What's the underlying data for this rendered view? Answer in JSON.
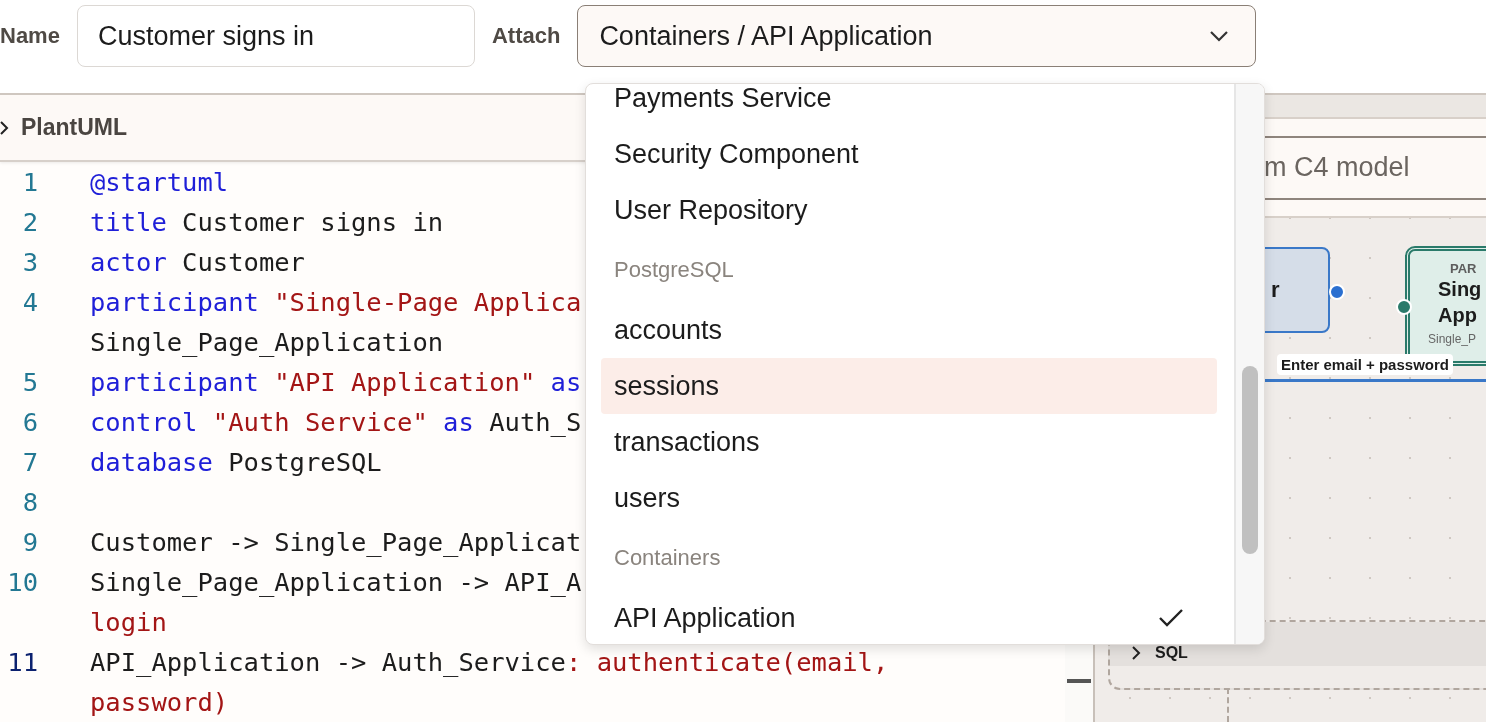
{
  "form": {
    "name_label": "Name",
    "name_value": "Customer signs in",
    "attach_label": "Attach",
    "attach_value": "Containers / API Application"
  },
  "editor": {
    "title": "PlantUML",
    "lines": [
      {
        "number": "1",
        "active": false,
        "rows": [
          [
            {
              "t": "@startuml",
              "kind": "keyword"
            }
          ]
        ]
      },
      {
        "number": "2",
        "active": false,
        "rows": [
          [
            {
              "t": "title",
              "kind": "keyword"
            },
            {
              "t": " Customer signs in",
              "kind": "plain"
            }
          ]
        ]
      },
      {
        "number": "3",
        "active": false,
        "rows": [
          [
            {
              "t": "actor",
              "kind": "keyword"
            },
            {
              "t": " Customer",
              "kind": "plain"
            }
          ]
        ]
      },
      {
        "number": "4",
        "active": false,
        "rows": [
          [
            {
              "t": "participant",
              "kind": "keyword"
            },
            {
              "t": " \"Single-Page Applica",
              "kind": "string"
            }
          ],
          [
            {
              "t": "Single_Page_Application",
              "kind": "plain"
            }
          ]
        ]
      },
      {
        "number": "5",
        "active": false,
        "rows": [
          [
            {
              "t": "participant",
              "kind": "keyword"
            },
            {
              "t": " \"API Application\"",
              "kind": "string"
            },
            {
              "t": " as",
              "kind": "keyword"
            }
          ]
        ]
      },
      {
        "number": "6",
        "active": false,
        "rows": [
          [
            {
              "t": "control",
              "kind": "keyword"
            },
            {
              "t": " \"Auth Service\"",
              "kind": "string"
            },
            {
              "t": " as",
              "kind": "keyword"
            },
            {
              "t": " Auth_S",
              "kind": "plain"
            }
          ]
        ]
      },
      {
        "number": "7",
        "active": false,
        "rows": [
          [
            {
              "t": "database",
              "kind": "keyword"
            },
            {
              "t": " PostgreSQL",
              "kind": "plain"
            }
          ]
        ]
      },
      {
        "number": "8",
        "active": false,
        "rows": [
          []
        ]
      },
      {
        "number": "9",
        "active": false,
        "rows": [
          [
            {
              "t": "Customer -> Single_Page_Applicat",
              "kind": "plain"
            }
          ]
        ]
      },
      {
        "number": "10",
        "active": false,
        "rows": [
          [
            {
              "t": "Single_Page_Application -> API_A",
              "kind": "plain"
            }
          ],
          [
            {
              "t": "login",
              "kind": "string"
            }
          ]
        ]
      },
      {
        "number": "11",
        "active": true,
        "rows": [
          [
            {
              "t": "API_Application -> Auth_Service",
              "kind": "plain"
            },
            {
              "t": ": authenticate(email,",
              "kind": "string"
            }
          ],
          [
            {
              "t": "password)",
              "kind": "string"
            }
          ]
        ]
      }
    ]
  },
  "preview": {
    "search_value": "m C4 model",
    "person_node": {
      "name": "r"
    },
    "container_node": {
      "tag": "PAR",
      "title_lines": [
        "Sing",
        "App"
      ],
      "subtitle": "Single_P"
    },
    "edge_label": "Enter email + password",
    "group_label": "SQL"
  },
  "dropdown": {
    "items": [
      {
        "kind": "option",
        "label": "Payments Service",
        "selected": false,
        "highlighted": false
      },
      {
        "kind": "option",
        "label": "Security Component",
        "selected": false,
        "highlighted": false
      },
      {
        "kind": "option",
        "label": "User Repository",
        "selected": false,
        "highlighted": false
      },
      {
        "kind": "group",
        "label": "PostgreSQL"
      },
      {
        "kind": "option",
        "label": "accounts",
        "selected": false,
        "highlighted": false
      },
      {
        "kind": "option",
        "label": "sessions",
        "selected": false,
        "highlighted": true
      },
      {
        "kind": "option",
        "label": "transactions",
        "selected": false,
        "highlighted": false
      },
      {
        "kind": "option",
        "label": "users",
        "selected": false,
        "highlighted": false
      },
      {
        "kind": "group",
        "label": "Containers"
      },
      {
        "kind": "option",
        "label": "API Application",
        "selected": true,
        "highlighted": false
      }
    ]
  }
}
